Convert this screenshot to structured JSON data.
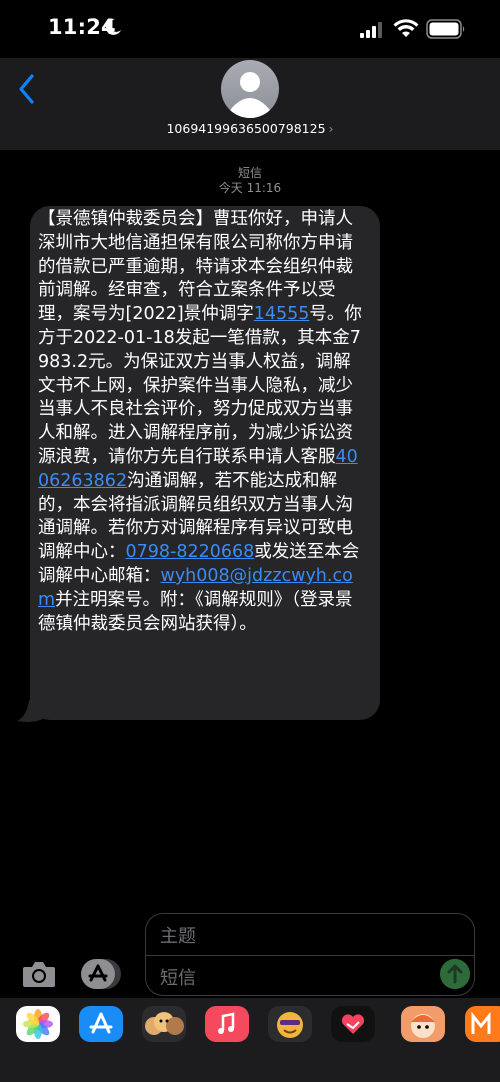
{
  "status_bar": {
    "time": "11:24"
  },
  "header": {
    "contact": "10694199636500798125",
    "chevron": "›"
  },
  "thread": {
    "service_label": "短信",
    "timestamp": "今天 11:16"
  },
  "message": {
    "segments": [
      {
        "text": "【景德镇仲裁委员会】",
        "link": false
      },
      {
        "text": "曹珏",
        "link": false
      },
      {
        "text": "你好，申请人深圳市大地信通担保有限公司称你方申请的借款已严重逾期，特请求本会组织仲裁前调解。经审查，符合立案条件予以受理，案号为[2022]景仲调字",
        "link": false
      },
      {
        "text": "14555",
        "link": true
      },
      {
        "text": "号。你方于2022-01-18发起一笔借款，其本金7983.2元。为保证双方当事人权益，调解文书不上网，保护案件当事人隐私，减少当事人不良社会评价，努力促成双方当事人和解。进入调解程序前，为减少诉讼资源浪费，请你方先自行联系申请人客服",
        "link": false
      },
      {
        "text": "4006263862",
        "link": true
      },
      {
        "text": "沟通调解，若不能达成和解的，本会将指派调解员组织双方当事人沟通调解。若你方对调解程序有异议可致电调解中心：",
        "link": false
      },
      {
        "text": "0798-8220668",
        "link": true
      },
      {
        "text": "或发送至本会调解中心邮箱：",
        "link": false
      },
      {
        "text": "wyh008@jdzzcwyh.com",
        "link": true
      },
      {
        "text": "并注明案号。附：《调解规则》（登录景德镇仲裁委员会网站获得）。",
        "link": false
      }
    ]
  },
  "composer": {
    "subject_placeholder": "主题",
    "body_placeholder": "短信"
  },
  "colors": {
    "link": "#3a8cf5",
    "bubble": "#262628",
    "header": "#1c1c1e",
    "accent": "#0a84ff"
  },
  "app_drawer": [
    "photos-icon",
    "app-store-icon",
    "memoji-icon",
    "music-icon",
    "animoji-icon",
    "digital-touch-icon",
    "sticker-icon",
    "mango-app-icon"
  ]
}
